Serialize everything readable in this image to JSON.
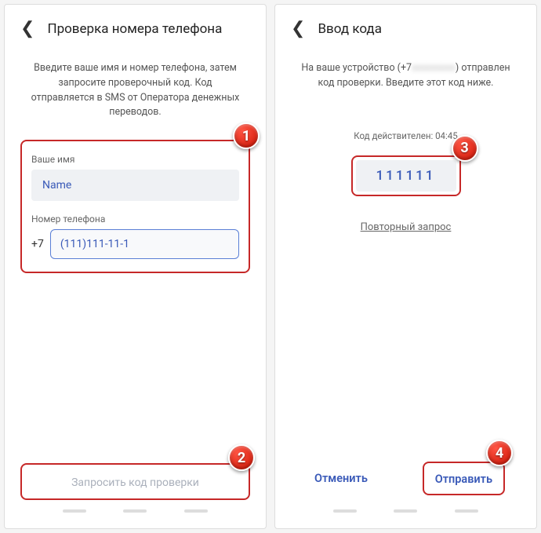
{
  "screen1": {
    "title": "Проверка номера телефона",
    "instruction": "Введите ваше имя и номер телефона, затем запросите проверочный код. Код отправляется в SMS от Оператора денежных переводов.",
    "name_label": "Ваше имя",
    "name_value": "Name",
    "phone_label": "Номер телефона",
    "phone_prefix": "+7",
    "phone_value": "(111)111-11-1",
    "request_button": "Запросить код проверки"
  },
  "screen2": {
    "title": "Ввод кода",
    "info_prefix": "На ваше устройство (+7",
    "info_hidden": "xxxxxxxxx",
    "info_suffix": ") отправлен код проверки. Введите этот код ниже.",
    "valid_label": "Код действителен: 04:45",
    "code_value": "111111",
    "resend_link": "Повторный запрос",
    "cancel_button": "Отменить",
    "submit_button": "Отправить"
  },
  "badges": {
    "b1": "1",
    "b2": "2",
    "b3": "3",
    "b4": "4"
  }
}
